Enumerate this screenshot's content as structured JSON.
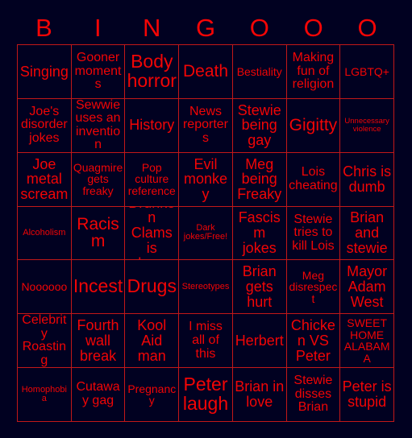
{
  "card": {
    "title_letters": [
      "B",
      "I",
      "N",
      "G",
      "O",
      "O",
      "O"
    ],
    "colors": {
      "background": "#010121",
      "text": "#f20505",
      "grid_line": "#c21818",
      "header_text": "#f50505"
    },
    "grid_size": {
      "columns": 7,
      "rows": 7
    },
    "cells": [
      [
        {
          "text": "Singing",
          "size": "l"
        },
        {
          "text": "Gooner moments",
          "size": "m"
        },
        {
          "text": "Body horror",
          "size": "xxl"
        },
        {
          "text": "Death",
          "size": "xl"
        },
        {
          "text": "Bestiality",
          "size": "s"
        },
        {
          "text": "Making fun of religion",
          "size": "m"
        },
        {
          "text": "LGBTQ+",
          "size": "s"
        }
      ],
      [
        {
          "text": "Joe's disorder jokes",
          "size": "m"
        },
        {
          "text": "Sewwie uses an invention",
          "size": "m"
        },
        {
          "text": "History",
          "size": "l"
        },
        {
          "text": "News reporters",
          "size": "m"
        },
        {
          "text": "Stewie being gay",
          "size": "l"
        },
        {
          "text": "Gigitty",
          "size": "xl"
        },
        {
          "text": "Unnecessary violence",
          "size": "xxs"
        }
      ],
      [
        {
          "text": "Joe metal scream",
          "size": "l"
        },
        {
          "text": "Quagmire gets freaky",
          "size": "s"
        },
        {
          "text": "Pop culture reference",
          "size": "s"
        },
        {
          "text": "Evil monkey",
          "size": "l"
        },
        {
          "text": "Meg being Freaky",
          "size": "l"
        },
        {
          "text": "Lois cheating",
          "size": "m"
        },
        {
          "text": "Chris is dumb",
          "size": "l"
        }
      ],
      [
        {
          "text": "Alcoholism",
          "size": "xs"
        },
        {
          "text": "Racism",
          "size": "xl"
        },
        {
          "text": "Drunken Clams is shown",
          "size": "l"
        },
        {
          "text": "Dark jokes/Free!",
          "size": "xs"
        },
        {
          "text": "Fascism jokes",
          "size": "l"
        },
        {
          "text": "Stewie tries to kill Lois",
          "size": "m"
        },
        {
          "text": "Brian and stewie",
          "size": "l"
        }
      ],
      [
        {
          "text": "Noooooo",
          "size": "s"
        },
        {
          "text": "Incest",
          "size": "xxl"
        },
        {
          "text": "Drugs",
          "size": "xxl"
        },
        {
          "text": "Stereotypes",
          "size": "xs"
        },
        {
          "text": "Brian gets hurt",
          "size": "l"
        },
        {
          "text": "Meg disrespect",
          "size": "s"
        },
        {
          "text": "Mayor Adam West",
          "size": "l"
        }
      ],
      [
        {
          "text": "Celebrity Roasting",
          "size": "m"
        },
        {
          "text": "Fourth wall break",
          "size": "l"
        },
        {
          "text": "Kool Aid man",
          "size": "l"
        },
        {
          "text": "I miss all of this",
          "size": "m"
        },
        {
          "text": "Herbert",
          "size": "l"
        },
        {
          "text": "Chicken VS Peter",
          "size": "l"
        },
        {
          "text": "SWEET HOME ALABAMA",
          "size": "s"
        }
      ],
      [
        {
          "text": "Homophobia",
          "size": "xs"
        },
        {
          "text": "Cutaway gag",
          "size": "m"
        },
        {
          "text": "Pregnancy",
          "size": "s"
        },
        {
          "text": "Peter laugh",
          "size": "xxl"
        },
        {
          "text": "Brian in love",
          "size": "l"
        },
        {
          "text": "Stewie disses Brian",
          "size": "m"
        },
        {
          "text": "Peter is stupid",
          "size": "l"
        }
      ]
    ]
  }
}
